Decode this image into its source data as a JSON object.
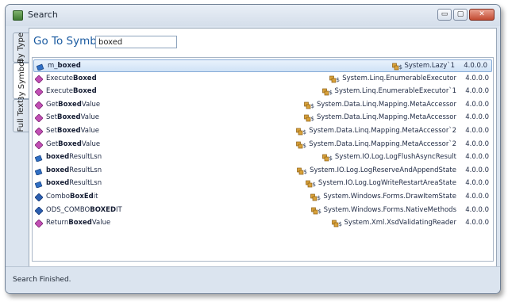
{
  "window": {
    "title": "Search",
    "min_glyph": "▭",
    "max_glyph": "▢",
    "close_glyph": "✕"
  },
  "tabs": [
    {
      "label": "By Type",
      "active": false
    },
    {
      "label": "By Symbol",
      "active": true
    },
    {
      "label": "Full Text",
      "active": false
    }
  ],
  "search": {
    "label": "Go To Symbol:",
    "value": "boxed"
  },
  "results": [
    {
      "pre": "m_",
      "bold": "boxed",
      "post": "",
      "icon": "field-icon",
      "container": "System.Lazy`1",
      "version": "4.0.0.0",
      "selected": true
    },
    {
      "pre": "Execute",
      "bold": "Boxed",
      "post": "",
      "icon": "method-icon",
      "container": "System.Linq.EnumerableExecutor",
      "version": "4.0.0.0"
    },
    {
      "pre": "Execute",
      "bold": "Boxed",
      "post": "",
      "icon": "method-icon",
      "container": "System.Linq.EnumerableExecutor`1",
      "version": "4.0.0.0"
    },
    {
      "pre": "Get",
      "bold": "Boxed",
      "post": "Value",
      "icon": "method-icon",
      "container": "System.Data.Linq.Mapping.MetaAccessor",
      "version": "4.0.0.0"
    },
    {
      "pre": "Set",
      "bold": "Boxed",
      "post": "Value",
      "icon": "method-icon",
      "container": "System.Data.Linq.Mapping.MetaAccessor",
      "version": "4.0.0.0"
    },
    {
      "pre": "Set",
      "bold": "Boxed",
      "post": "Value",
      "icon": "method-icon",
      "container": "System.Data.Linq.Mapping.MetaAccessor`2",
      "version": "4.0.0.0"
    },
    {
      "pre": "Get",
      "bold": "Boxed",
      "post": "Value",
      "icon": "method-icon",
      "container": "System.Data.Linq.Mapping.MetaAccessor`2",
      "version": "4.0.0.0"
    },
    {
      "pre": "",
      "bold": "boxed",
      "post": "ResultLsn",
      "icon": "field-icon",
      "container": "System.IO.Log.LogFlushAsyncResult",
      "version": "4.0.0.0"
    },
    {
      "pre": "",
      "bold": "boxed",
      "post": "ResultLsn",
      "icon": "field-icon",
      "container": "System.IO.Log.LogReserveAndAppendState",
      "version": "4.0.0.0"
    },
    {
      "pre": "",
      "bold": "boxed",
      "post": "ResultLsn",
      "icon": "field-icon",
      "container": "System.IO.Log.LogWriteRestartAreaState",
      "version": "4.0.0.0"
    },
    {
      "pre": "Combo",
      "bold": "BoxEd",
      "post": "it",
      "icon": "enum-icon",
      "container": "System.Windows.Forms.DrawItemState",
      "version": "4.0.0.0"
    },
    {
      "pre": "ODS_COMBO",
      "bold": "BOXED",
      "post": "IT",
      "icon": "enum-icon",
      "container": "System.Windows.Forms.NativeMethods",
      "version": "4.0.0.0"
    },
    {
      "pre": "Return",
      "bold": "Boxed",
      "post": "Value",
      "icon": "method-icon",
      "container": "System.Xml.XsdValidatingReader",
      "version": "4.0.0.0"
    }
  ],
  "status": {
    "text": "Search Finished."
  },
  "colors": {
    "method": "#c24fb5",
    "field": "#2f6fc4",
    "enum": "#2c5fb0",
    "class": "#d9a23a"
  }
}
